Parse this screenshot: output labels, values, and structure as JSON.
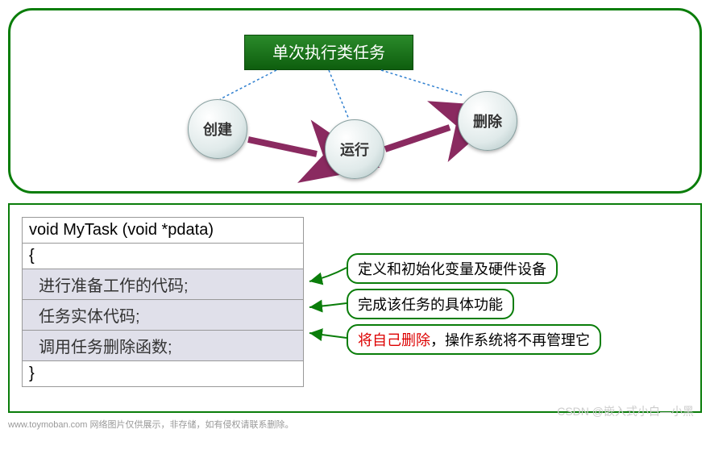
{
  "top": {
    "title": "单次执行类任务",
    "nodes": [
      "创建",
      "运行",
      "删除"
    ]
  },
  "code": {
    "signature": "void  MyTask (void *pdata)",
    "open": "{",
    "lines": [
      "进行准备工作的代码;",
      "任务实体代码;",
      "调用任务删除函数;"
    ],
    "close": "}"
  },
  "callouts": {
    "c1": "定义和初始化变量及硬件设备",
    "c2": "完成该任务的具体功能",
    "c3_red": "将自己删除",
    "c3_rest": "，操作系统将不再管理它"
  },
  "footer": {
    "site": "www.toymoban.com",
    "note": "网络图片仅供展示，非存储，如有侵权请联系删除。",
    "watermark": "CSDN @嵌入式小白—小黑"
  }
}
